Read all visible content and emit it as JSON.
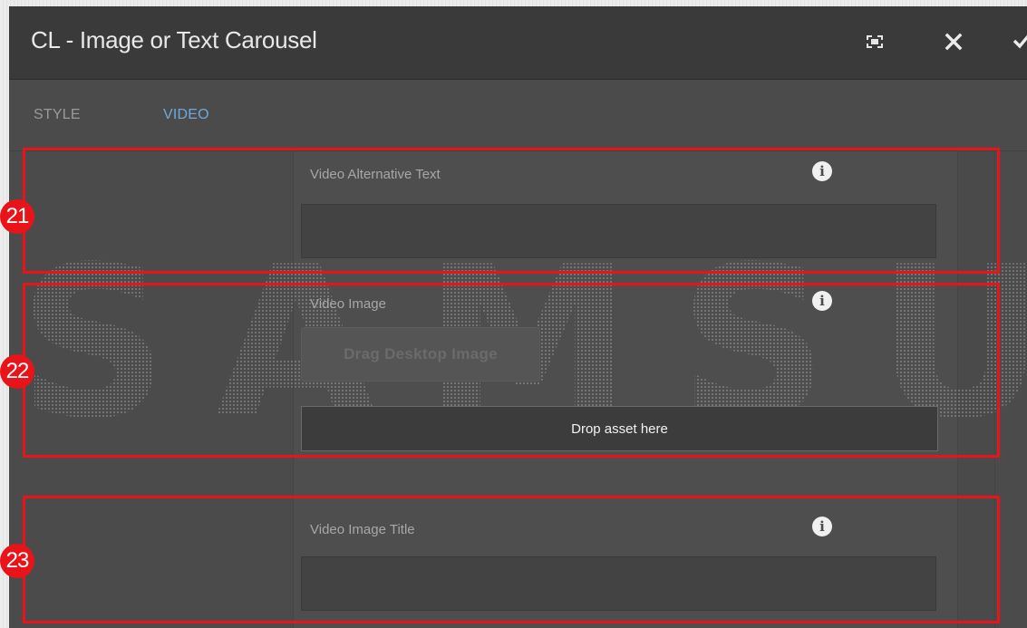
{
  "dialog": {
    "title": "CL - Image or Text Carousel",
    "toolbar": {
      "fullscreen_icon": "fullscreen-icon",
      "close_icon": "close-icon",
      "confirm_icon": "checkmark-icon"
    }
  },
  "tabs": [
    {
      "label": "STYLE",
      "active": false
    },
    {
      "label": "VIDEO",
      "active": true
    }
  ],
  "fields": {
    "video_alt_text": {
      "label": "Video Alternative Text",
      "value": "",
      "info_icon": "info-icon"
    },
    "video_image": {
      "label": "Video Image",
      "drag_button": "Drag Desktop Image",
      "drop_zone": "Drop asset here",
      "info_icon": "info-icon"
    },
    "video_image_title": {
      "label": "Video Image Title",
      "value": "",
      "info_icon": "info-icon"
    }
  },
  "watermark": "SAMSUNG",
  "annotations": [
    "21",
    "22",
    "23"
  ],
  "colors": {
    "accent": "#6fa8dc",
    "highlight": "#e8141a",
    "panel": "#4b4b4b",
    "titlebar": "#3a3a3a"
  }
}
